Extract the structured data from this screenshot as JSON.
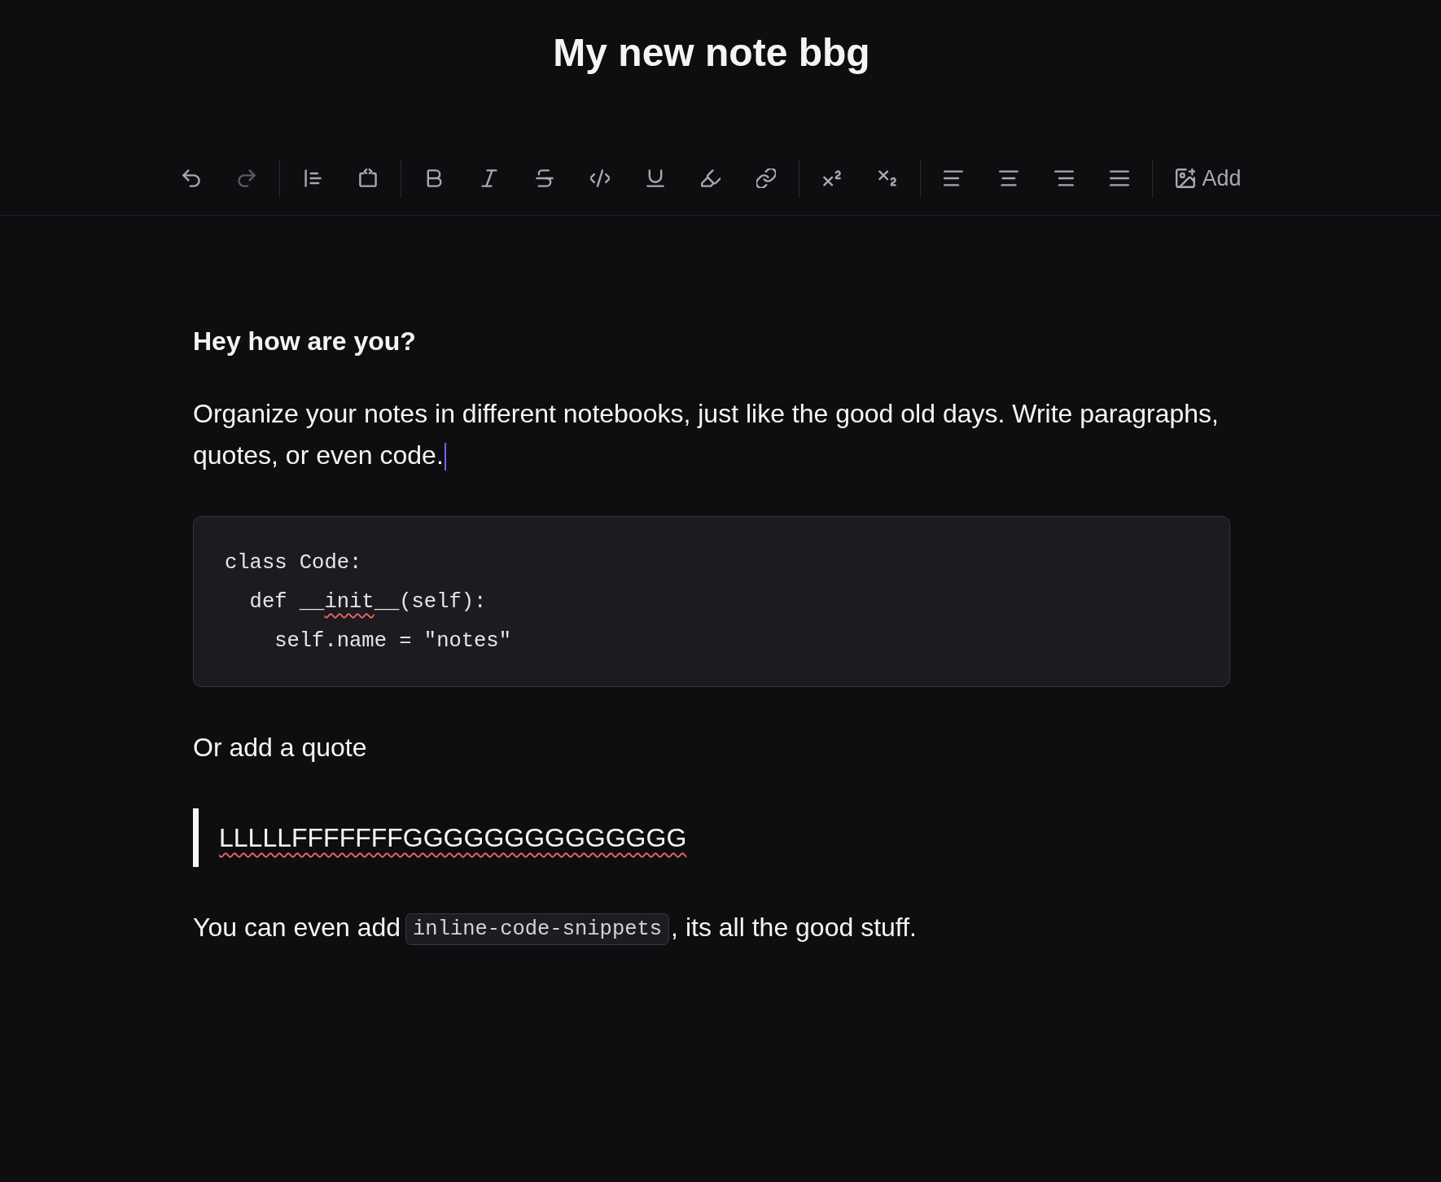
{
  "title": "My new note bbg",
  "toolbar": {
    "groups": [
      [
        {
          "kind": "undo",
          "disabled": false
        },
        {
          "kind": "redo",
          "disabled": true
        }
      ],
      [
        {
          "kind": "blockquote",
          "disabled": false
        },
        {
          "kind": "code_block",
          "disabled": false
        }
      ],
      [
        {
          "kind": "bold",
          "disabled": false
        },
        {
          "kind": "italic",
          "disabled": false
        },
        {
          "kind": "strikethrough",
          "disabled": false
        },
        {
          "kind": "code",
          "disabled": false
        },
        {
          "kind": "underline",
          "disabled": false
        },
        {
          "kind": "highlight",
          "disabled": false
        },
        {
          "kind": "link",
          "disabled": false
        }
      ],
      [
        {
          "kind": "superscript",
          "disabled": false
        },
        {
          "kind": "subscript",
          "disabled": false
        }
      ],
      [
        {
          "kind": "align_left",
          "disabled": false
        },
        {
          "kind": "align_center",
          "disabled": false
        },
        {
          "kind": "align_right",
          "disabled": false
        },
        {
          "kind": "align_justify",
          "disabled": false
        }
      ],
      [
        {
          "kind": "image",
          "label": "Add",
          "disabled": false
        }
      ]
    ]
  },
  "document": {
    "blocks": [
      {
        "kind": "heading",
        "text": "Hey how are you?",
        "caret": false
      },
      {
        "kind": "paragraph",
        "caret": true,
        "runs": [
          {
            "kind": "text",
            "text": "Organize your notes in different notebooks, just like the good old days. Write paragraphs, quotes, or even code.",
            "misspelled": false
          }
        ]
      },
      {
        "kind": "code_block",
        "caret": false,
        "lines": [
          {
            "runs": [
              {
                "text": "class Code:",
                "misspelled": false
              }
            ]
          },
          {
            "runs": [
              {
                "text": "  def __",
                "misspelled": false
              },
              {
                "text": "init",
                "misspelled": true
              },
              {
                "text": "__(self):",
                "misspelled": false
              }
            ]
          },
          {
            "runs": [
              {
                "text": "    self.name = \"notes\"",
                "misspelled": false
              }
            ]
          }
        ]
      },
      {
        "kind": "paragraph",
        "caret": false,
        "runs": [
          {
            "kind": "text",
            "text": "Or add a quote",
            "misspelled": false
          }
        ]
      },
      {
        "kind": "quote",
        "caret": false,
        "runs": [
          {
            "text": "LLLLLFFFFFFFGGGGGGGGGGGGGG",
            "misspelled": true
          }
        ]
      },
      {
        "kind": "paragraph",
        "caret": false,
        "runs": [
          {
            "kind": "text",
            "text": "You can even add",
            "misspelled": false
          },
          {
            "kind": "code",
            "text": "inline-code-snippets",
            "misspelled": false
          },
          {
            "kind": "text",
            "text": ", its all the good stuff.",
            "misspelled": false
          }
        ]
      }
    ]
  }
}
